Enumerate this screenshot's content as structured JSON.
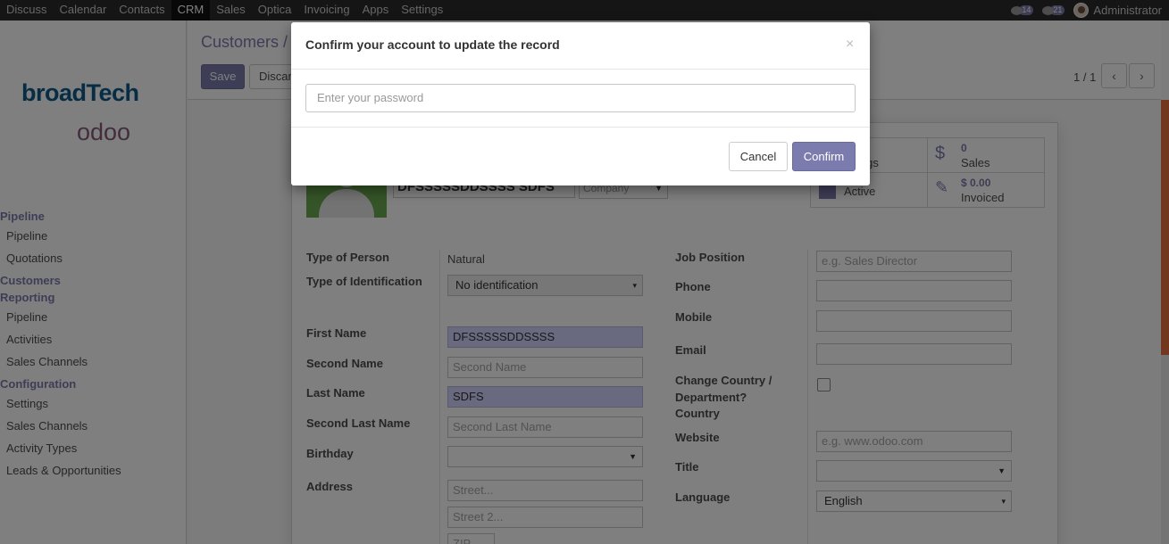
{
  "topbar": {
    "menu": [
      "Discuss",
      "Calendar",
      "Contacts",
      "CRM",
      "Sales",
      "Optica",
      "Invoicing",
      "Apps",
      "Settings"
    ],
    "active_menu": "CRM",
    "messages_count": "14",
    "activities_count": "21",
    "user_name": "Administrator"
  },
  "sidebar": {
    "logo_top": "broadTech",
    "logo_bottom": "odoo",
    "sections": [
      {
        "title": "Pipeline",
        "items": [
          "Pipeline",
          "Quotations"
        ]
      },
      {
        "title": "Customers",
        "items": []
      },
      {
        "title": "Reporting",
        "items": [
          "Pipeline",
          "Activities",
          "Sales Channels"
        ]
      },
      {
        "title": "Configuration",
        "items": [
          "Settings",
          "Sales Channels",
          "Activity Types",
          "Leads & Opportunities"
        ]
      }
    ]
  },
  "control_panel": {
    "breadcrumb": "Customers /",
    "save_label": "Save",
    "discard_label": "Discard",
    "pager": "1 / 1",
    "prev_icon": "chevron-left-icon",
    "next_icon": "chevron-right-icon"
  },
  "record": {
    "name": "DFSSSSSDDSSSS SDFS",
    "company_type": "Company",
    "stats": {
      "meetings_label": "ings",
      "sales_count": "0",
      "sales_label": "Sales",
      "active_label": "Active",
      "invoiced_amount": "$ 0.00",
      "invoiced_label": "Invoiced"
    },
    "left_fields": {
      "type_of_person_label": "Type of Person",
      "type_of_person_value": "Natural",
      "type_of_identification_label": "Type of Identification",
      "type_of_identification_value": "No identification",
      "first_name_label": "First Name",
      "first_name_value": "DFSSSSSDDSSSS",
      "second_name_label": "Second Name",
      "second_name_placeholder": "Second Name",
      "last_name_label": "Last Name",
      "last_name_value": "SDFS",
      "second_last_name_label": "Second Last Name",
      "second_last_name_placeholder": "Second Last Name",
      "birthday_label": "Birthday",
      "address_label": "Address",
      "street_placeholder": "Street...",
      "street2_placeholder": "Street 2...",
      "zip_placeholder": "ZIP"
    },
    "right_fields": {
      "job_position_label": "Job Position",
      "job_position_placeholder": "e.g. Sales Director",
      "phone_label": "Phone",
      "mobile_label": "Mobile",
      "email_label": "Email",
      "change_country_label_1": "Change Country /",
      "change_country_label_2": "Department?",
      "country_label": "Country",
      "website_label": "Website",
      "website_placeholder": "e.g. www.odoo.com",
      "title_label": "Title",
      "language_label": "Language",
      "language_value": "English"
    }
  },
  "modal": {
    "title": "Confirm your account to update the record",
    "close_symbol": "×",
    "password_placeholder": "Enter your password",
    "cancel_label": "Cancel",
    "confirm_label": "Confirm"
  },
  "colors": {
    "accent": "#7c7bad",
    "topbar": "#2b2b2b",
    "required_field": "#d2d2ff",
    "scroll_accent": "#e56e3c"
  }
}
